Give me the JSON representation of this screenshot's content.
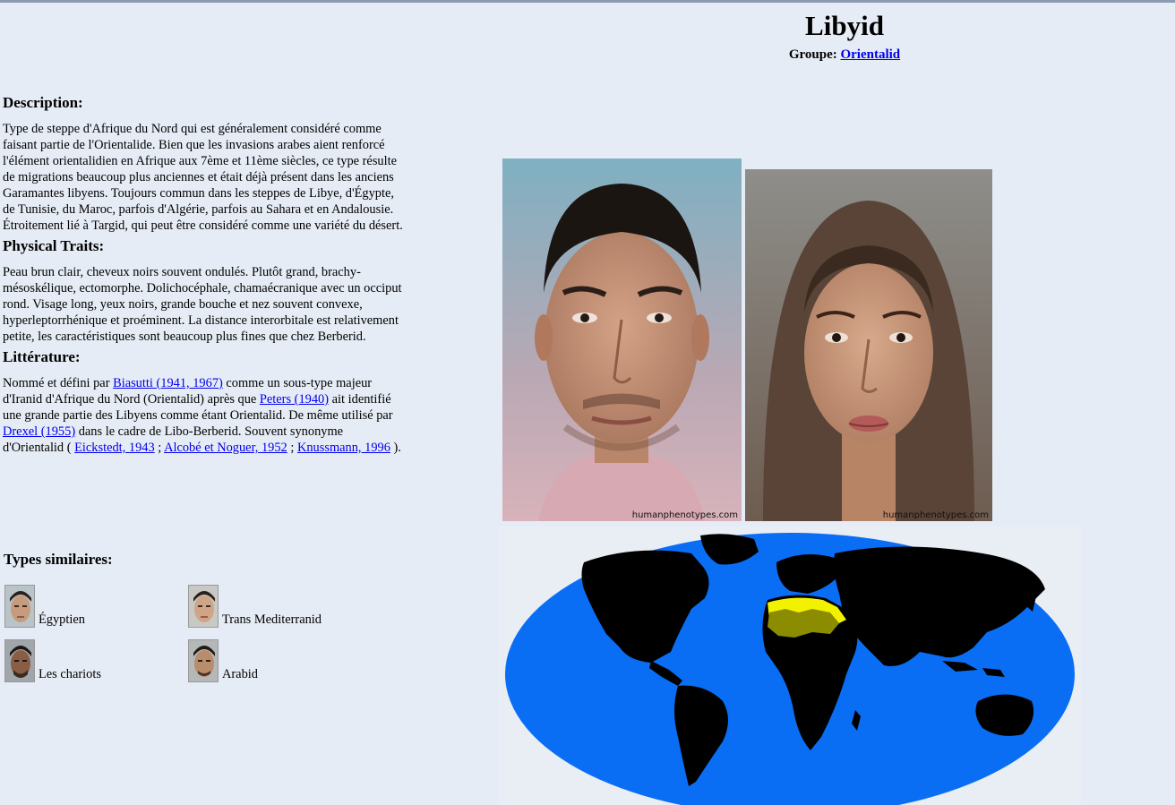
{
  "header": {
    "title": "Libyid",
    "groupe_label": "Groupe:",
    "groupe_link": "Orientalid"
  },
  "description": {
    "heading": "Description:",
    "text": "Type de steppe d'Afrique du Nord qui est généralement considéré comme faisant partie de l'Orientalide. Bien que les invasions arabes aient renforcé l'élément orientalidien en Afrique aux 7ème et 11ème siècles, ce type résulte de migrations beaucoup plus anciennes et était déjà présent dans les anciens Garamantes libyens. Toujours commun dans les steppes de Libye, d'Égypte, de Tunisie, du Maroc, parfois d'Algérie, parfois au Sahara et en Andalousie. Étroitement lié à Targid, qui peut être considéré comme une variété du désert."
  },
  "physical": {
    "heading": "Physical Traits:",
    "text": "Peau brun clair, cheveux noirs souvent ondulés. Plutôt grand, brachy-mésoskélique, ectomorphe. Dolichocéphale, chamaécranique avec un occiput rond. Visage long, yeux noirs, grande bouche et nez souvent convexe, hyperleptorrhénique et proéminent. La distance interorbitale est relativement petite, les caractéristiques sont beaucoup plus fines que chez Berberid."
  },
  "literature": {
    "heading": "Littérature:",
    "t1": "Nommé et défini par ",
    "l1": "Biasutti (1941, 1967)",
    "t2": " comme un sous-type majeur d'Iranid d'Afrique du Nord (Orientalid) après que ",
    "l2": "Peters (1940)",
    "t3": " ait identifié une grande partie des Libyens comme étant Orientalid. De même utilisé par ",
    "l3": "Drexel (1955)",
    "t4": " dans le cadre de Libo-Berberid. Souvent synonyme d'Orientalid ( ",
    "l4": "Eickstedt, 1943",
    "t5": " ; ",
    "l5": "Alcobé et Noguer, 1952",
    "t6": " ; ",
    "l6": "Knussmann, 1996",
    "t7": " )."
  },
  "similar": {
    "heading": "Types similaires:",
    "items": [
      {
        "label": "Égyptien"
      },
      {
        "label": "Trans Mediterranid"
      },
      {
        "label": "Les chariots"
      },
      {
        "label": "Arabid"
      }
    ]
  },
  "photos": {
    "credit": "humanphenotypes.com"
  },
  "colors": {
    "background": "#e6ecf5",
    "link": "#0000ee",
    "ocean": "#0a6ef5",
    "land": "#000000",
    "region_core": "#8c8c00",
    "region_outer": "#f2f200"
  }
}
